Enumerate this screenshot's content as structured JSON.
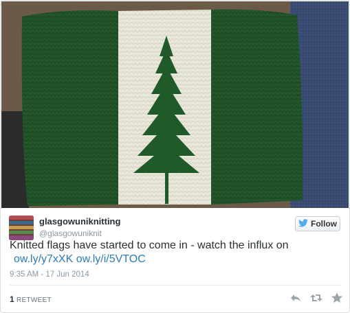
{
  "user": {
    "name": "glasgowuniknitting",
    "handle": "@glasgowuniknit"
  },
  "follow": {
    "label": "Follow"
  },
  "tweet": {
    "text": "Knitted flags have started to come in - watch the influx on",
    "link1": "ow.ly/y7xXK",
    "link2": "ow.ly/i/5VTOC"
  },
  "timestamp": "9:35 AM - 17 Jun 2014",
  "stats": {
    "retweet_count": "1",
    "retweet_label": "RETWEET"
  },
  "colors": {
    "accent": "#2b7bb9",
    "knit_green": "#1f4d25",
    "knit_white": "#e9e8dc"
  },
  "icons": [
    "twitter-bird-icon",
    "reply-icon",
    "retweet-icon",
    "favorite-icon"
  ]
}
